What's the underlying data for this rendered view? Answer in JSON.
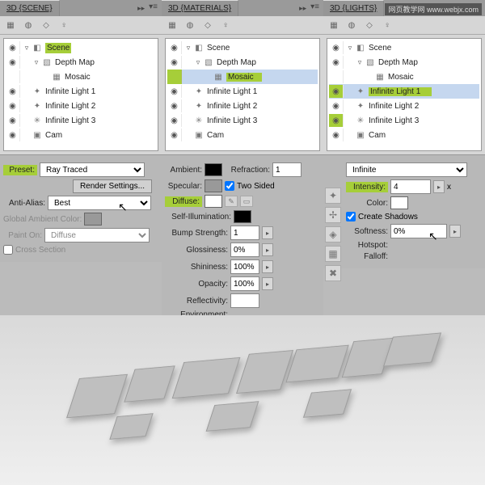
{
  "watermark": "网页教学网\nwww.webjx.com",
  "panels": {
    "scene": {
      "tab": "3D {SCENE}",
      "tree": {
        "root": "Scene",
        "depth_map": "Depth Map",
        "mosaic": "Mosaic",
        "light1": "Infinite Light 1",
        "light2": "Infinite Light 2",
        "light3": "Infinite Light 3",
        "cam": "Cam"
      },
      "opts": {
        "preset_lbl": "Preset:",
        "preset_val": "Ray Traced",
        "render_btn": "Render Settings...",
        "aa_lbl": "Anti-Alias:",
        "aa_val": "Best",
        "gac_lbl": "Global Ambient Color:",
        "paint_lbl": "Paint On:",
        "paint_val": "Diffuse",
        "cross_lbl": "Cross Section"
      }
    },
    "materials": {
      "tab": "3D {MATERIALS}",
      "opts": {
        "ambient_lbl": "Ambient:",
        "refraction_lbl": "Refraction:",
        "refraction_val": "1",
        "specular_lbl": "Specular:",
        "two_sided_lbl": "Two Sided",
        "diffuse_lbl": "Diffuse:",
        "self_illum_lbl": "Self-Illumination:",
        "bump_lbl": "Bump Strength:",
        "bump_val": "1",
        "gloss_lbl": "Glossiness:",
        "gloss_val": "0%",
        "shine_lbl": "Shininess:",
        "shine_val": "100%",
        "opacity_lbl": "Opacity:",
        "opacity_val": "100%",
        "reflect_lbl": "Reflectivity:",
        "env_lbl": "Environment:"
      }
    },
    "lights": {
      "tab": "3D {LIGHTS}",
      "opts": {
        "type_val": "Infinite",
        "intensity_lbl": "Intensity:",
        "intensity_val": "4",
        "x_lbl": "x",
        "color_lbl": "Color:",
        "shadows_lbl": "Create Shadows",
        "softness_lbl": "Softness:",
        "softness_val": "0%",
        "hotspot_lbl": "Hotspot:",
        "falloff_lbl": "Falloff:"
      }
    }
  }
}
